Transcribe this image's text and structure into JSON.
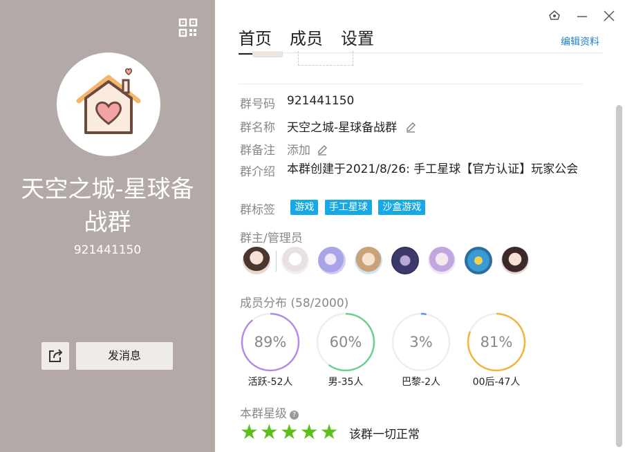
{
  "profile": {
    "group_name": "天空之城-星球备战群",
    "group_id": "921441150",
    "send_message_label": "发消息"
  },
  "tabs": [
    {
      "label": "首页"
    },
    {
      "label": "成员"
    },
    {
      "label": "设置"
    }
  ],
  "edit_link": "编辑资料",
  "info": {
    "id_label": "群号码",
    "id_value": "921441150",
    "name_label": "群名称",
    "name_value": "天空之城-星球备战群",
    "remark_label": "群备注",
    "remark_value": "添加",
    "intro_label": "群介绍",
    "intro_value": "本群创建于2021/8/26: 手工星球【官方认证】玩家公会",
    "tags_label": "群标签",
    "tags": [
      "游戏",
      "手工星球",
      "沙盒游戏"
    ]
  },
  "admins": {
    "title": "群主/管理员"
  },
  "distribution": {
    "title": "成员分布",
    "count": "(58/2000)",
    "stats": [
      {
        "percent_label": "89%",
        "value": 0.89,
        "label": "活跃-52人",
        "color": "#b38be6"
      },
      {
        "percent_label": "60%",
        "value": 0.6,
        "label": "男-35人",
        "color": "#6ccf8e"
      },
      {
        "percent_label": "3%",
        "value": 0.03,
        "label": "巴黎-2人",
        "color": "#5b95e8"
      },
      {
        "percent_label": "81%",
        "value": 0.81,
        "label": "00后-47人",
        "color": "#f2b43a"
      }
    ]
  },
  "rating": {
    "title": "本群星级",
    "help": "?",
    "stars": 5,
    "status": "该群一切正常",
    "star_color": "#5cbf1c"
  },
  "colors": {
    "left_panel": "#b3a9a6",
    "accent_blue": "#17a9e6",
    "link_blue": "#1e7fcd"
  }
}
